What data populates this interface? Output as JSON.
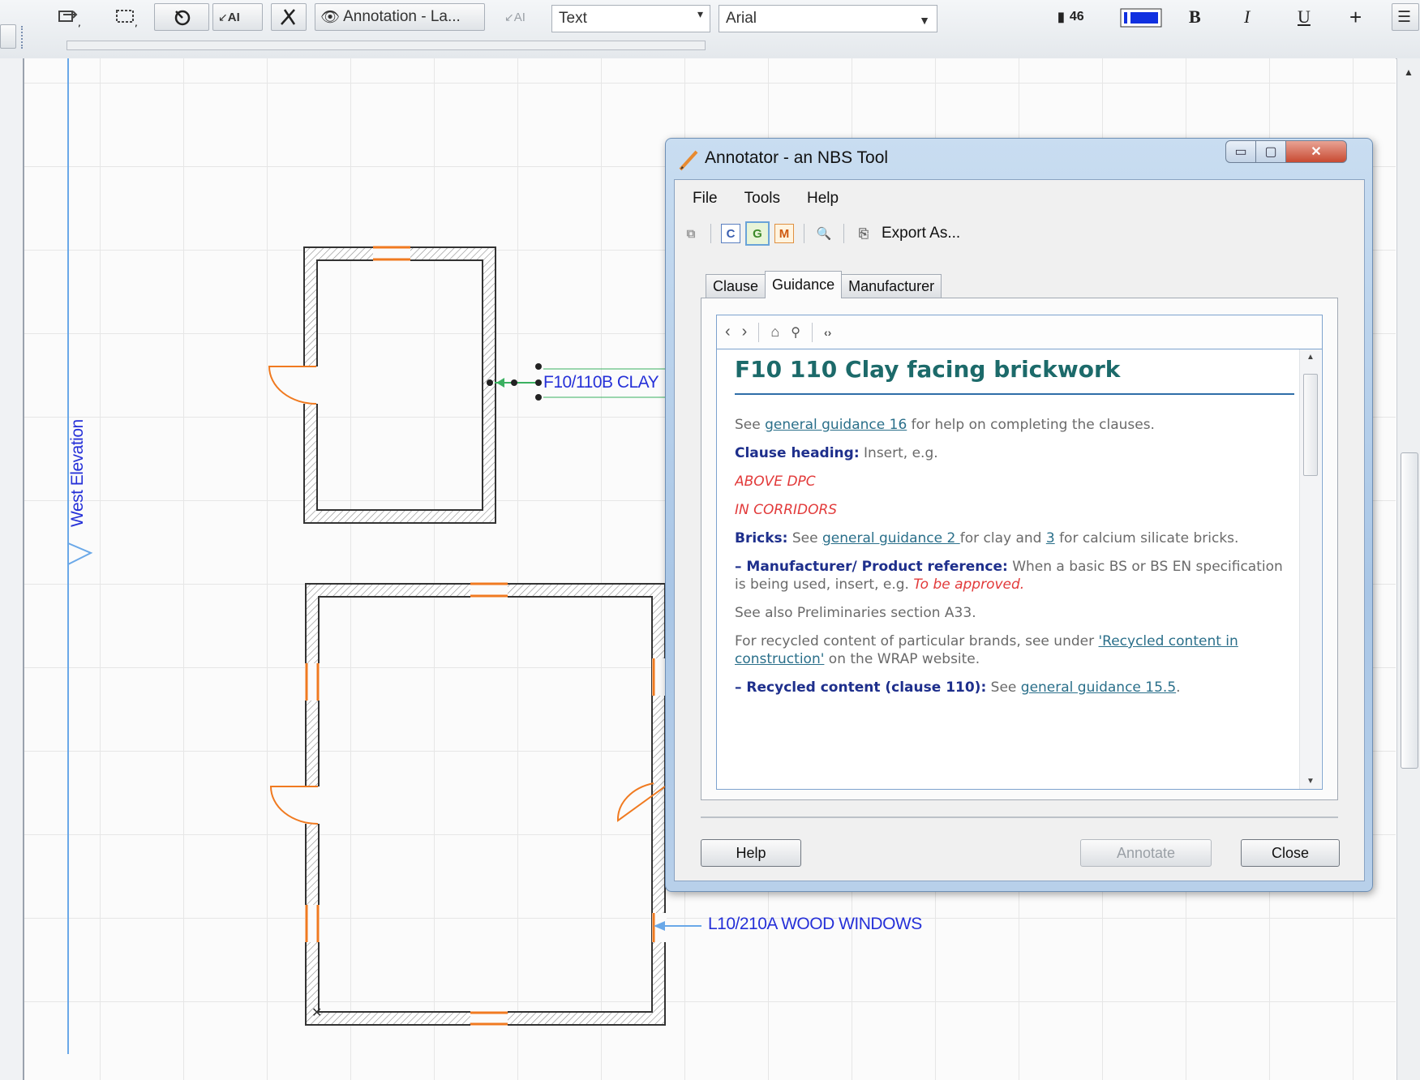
{
  "toolbar": {
    "annotation_layer": "Annotation - La...",
    "text_style": "Text",
    "font_name": "Arial",
    "font_size": "46",
    "ai_label": "AI",
    "bold": "B",
    "italic": "I",
    "underline": "U",
    "strike": "+"
  },
  "canvas": {
    "west_elevation": "West Elevation",
    "label_brick": "F10/110B CLAY",
    "label_window": "L10/210A WOOD WINDOWS"
  },
  "dialog": {
    "title": "Annotator - an NBS Tool",
    "menu": [
      "File",
      "Tools",
      "Help"
    ],
    "icons": {
      "c": "C",
      "g": "G",
      "m": "M"
    },
    "export_label": "Export As...",
    "tabs": [
      "Clause",
      "Guidance",
      "Manufacturer"
    ],
    "active_tab": "Guidance",
    "content": {
      "heading": "F10 110 Clay facing brickwork",
      "p1_pre": "See ",
      "p1_link": "general guidance 16",
      "p1_post": " for help on completing the clauses.",
      "clause_heading_label": "Clause heading:",
      "clause_heading_text": " Insert, e.g.",
      "ex1": "ABOVE DPC",
      "ex2": "IN CORRIDORS",
      "bricks_label": "Bricks:",
      "bricks_pre": " See ",
      "bricks_link": "general guidance 2 ",
      "bricks_mid": "for clay and ",
      "bricks_link2": "3",
      "bricks_post": " for calcium silicate bricks.",
      "manu_label": "– Manufacturer/ Product reference:",
      "manu_text": " When a basic BS or BS EN specification is being used, insert, e.g. ",
      "manu_red": "To be approved.",
      "see_also": "See also Preliminaries section A33.",
      "recycled_pre": "For recycled content of particular brands, see under ",
      "recycled_link": "'Recycled content in construction'",
      "recycled_post": " on the WRAP website.",
      "rc_label": "– Recycled content (clause 110):",
      "rc_pre": " See ",
      "rc_link": "general guidance 15.5",
      "rc_post": "."
    },
    "buttons": {
      "help": "Help",
      "annotate": "Annotate",
      "close": "Close"
    }
  },
  "colors": {
    "accent_blue": "#2530d8",
    "heading_teal": "#1c6a6a",
    "door_orange": "#f07a20",
    "guide_blue": "#6aa8e8"
  }
}
